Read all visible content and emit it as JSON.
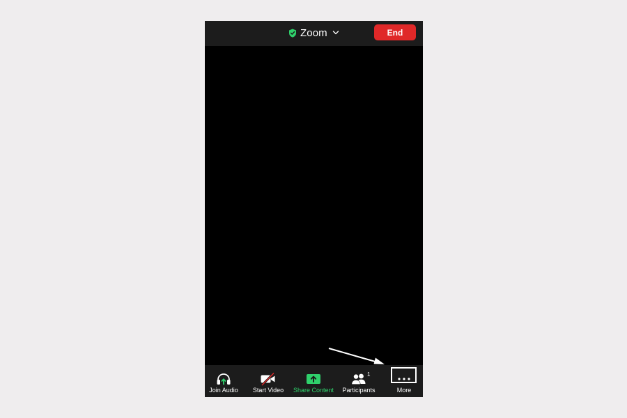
{
  "header": {
    "meeting_title": "Zoom",
    "end_label": "End"
  },
  "toolbar": {
    "join_audio": "Join Audio",
    "start_video": "Start Video",
    "share_content": "Share Content",
    "participants": "Participants",
    "participants_count": "1",
    "more": "More"
  },
  "colors": {
    "end_button": "#e02828",
    "share_green": "#2fd06b",
    "bar_background": "#1c1c1c",
    "video_background": "#000000",
    "page_background": "#efedee"
  },
  "icons": {
    "security": "shield-check-icon",
    "title_dropdown": "chevron-down-icon",
    "join_audio": "headphones-icon",
    "start_video": "camera-off-icon",
    "share_content": "share-upload-icon",
    "participants": "people-icon",
    "more": "ellipsis-icon",
    "annotation": "arrow-annotation-icon"
  }
}
